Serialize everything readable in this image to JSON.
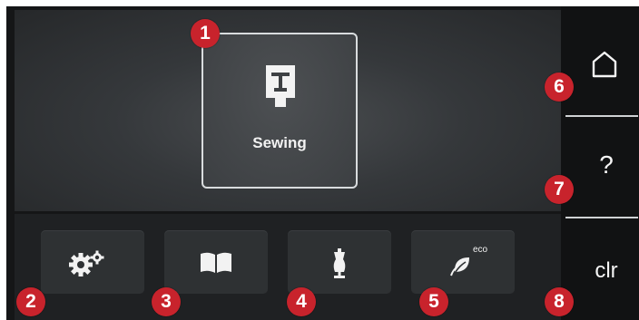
{
  "main": {
    "tile": {
      "label": "Sewing",
      "icon": "presser-foot-icon"
    }
  },
  "bottom_bar": {
    "buttons": [
      {
        "icon": "settings-gears-icon"
      },
      {
        "icon": "book-tutorial-icon"
      },
      {
        "icon": "dress-form-icon"
      },
      {
        "icon": "eco-leaf-icon",
        "icon_text": "eco"
      }
    ]
  },
  "side_panel": {
    "home": {
      "icon": "home-icon"
    },
    "help": {
      "label": "?"
    },
    "clear": {
      "label": "clr"
    }
  },
  "callouts": [
    "1",
    "2",
    "3",
    "4",
    "5",
    "6",
    "7",
    "8"
  ],
  "colors": {
    "callout": "#c8232c",
    "panel": "#35383b",
    "button": "#2e3133",
    "text": "#f2f2f2"
  }
}
